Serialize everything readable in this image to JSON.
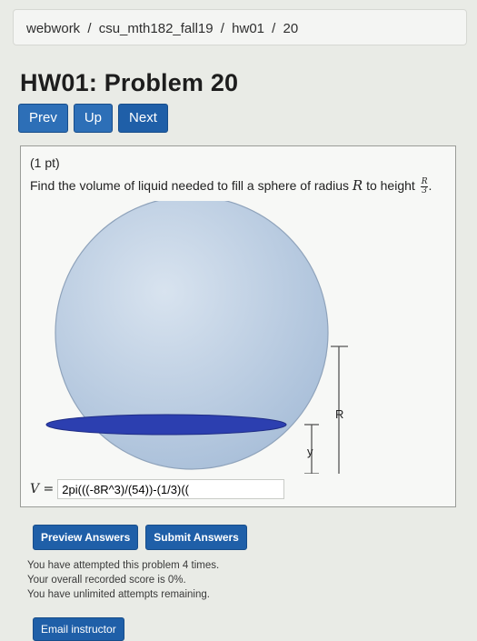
{
  "breadcrumb": {
    "items": [
      "webwork",
      "csu_mth182_fall19",
      "hw01",
      "20"
    ],
    "separator": "/"
  },
  "title": "HW01: Problem 20",
  "nav": {
    "prev": "Prev",
    "up": "Up",
    "next": "Next"
  },
  "problem": {
    "points": "(1 pt)",
    "question_text": "Find the volume of liquid needed to fill a sphere of radius",
    "variable_R": "R",
    "question_mid": "to height",
    "fraction_num": "R",
    "fraction_den": "3",
    "question_end": ".",
    "diagram": {
      "label_R": "R",
      "label_y": "y"
    },
    "answer_label": "V =",
    "answer_value": "2pi(((-8R^3)/(54))-(1/3)(("
  },
  "actions": {
    "preview": "Preview Answers",
    "submit": "Submit Answers"
  },
  "status": [
    "You have attempted this problem 4 times.",
    "Your overall recorded score is 0%.",
    "You have unlimited attempts remaining."
  ],
  "email": "Email instructor",
  "colors": {
    "button": "#1f5fa8",
    "liquid": "#2c3fb0",
    "sphere": "#b9cbe0"
  }
}
